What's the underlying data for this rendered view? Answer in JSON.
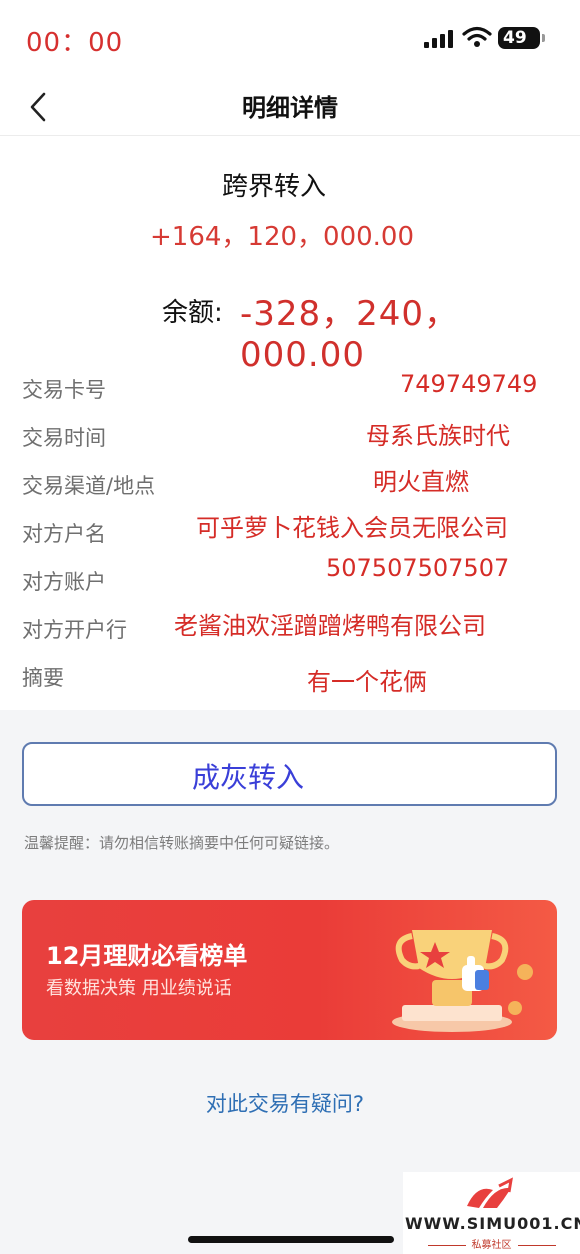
{
  "status_bar": {
    "time": "00：00",
    "battery": "49"
  },
  "nav": {
    "title": "明细详情"
  },
  "transaction": {
    "type": "跨界转入",
    "amount": "+164，120，000.00",
    "balance_label": "余额:",
    "balance_value": "-328，240，000.00"
  },
  "details": [
    {
      "label": "交易卡号",
      "value": "749749749"
    },
    {
      "label": "交易时间",
      "value": "母系氏族时代"
    },
    {
      "label": "交易渠道/地点",
      "value": "明火直燃"
    },
    {
      "label": "对方户名",
      "value": "可乎萝卜花钱入会员无限公司"
    },
    {
      "label": "对方账户",
      "value": "507507507507"
    },
    {
      "label": "对方开户行",
      "value": "老酱油欢淫蹭蹭烤鸭有限公司"
    },
    {
      "label": "摘要",
      "value": "有一个花俩"
    }
  ],
  "action_button": {
    "label": "成灰转入"
  },
  "warning": "温馨提醒：请勿相信转账摘要中任何可疑链接。",
  "promo": {
    "title": "12月理财必看榜单",
    "subtitle": "看数据决策 用业绩说话"
  },
  "question_link": "对此交易有疑问?",
  "watermark": {
    "url": "WWW.SIMU001.CN",
    "subtitle": "私募社区"
  },
  "colors": {
    "accent_red": "#d52c27",
    "link_blue": "#2f6fb4",
    "button_text": "#3a3fd8"
  }
}
